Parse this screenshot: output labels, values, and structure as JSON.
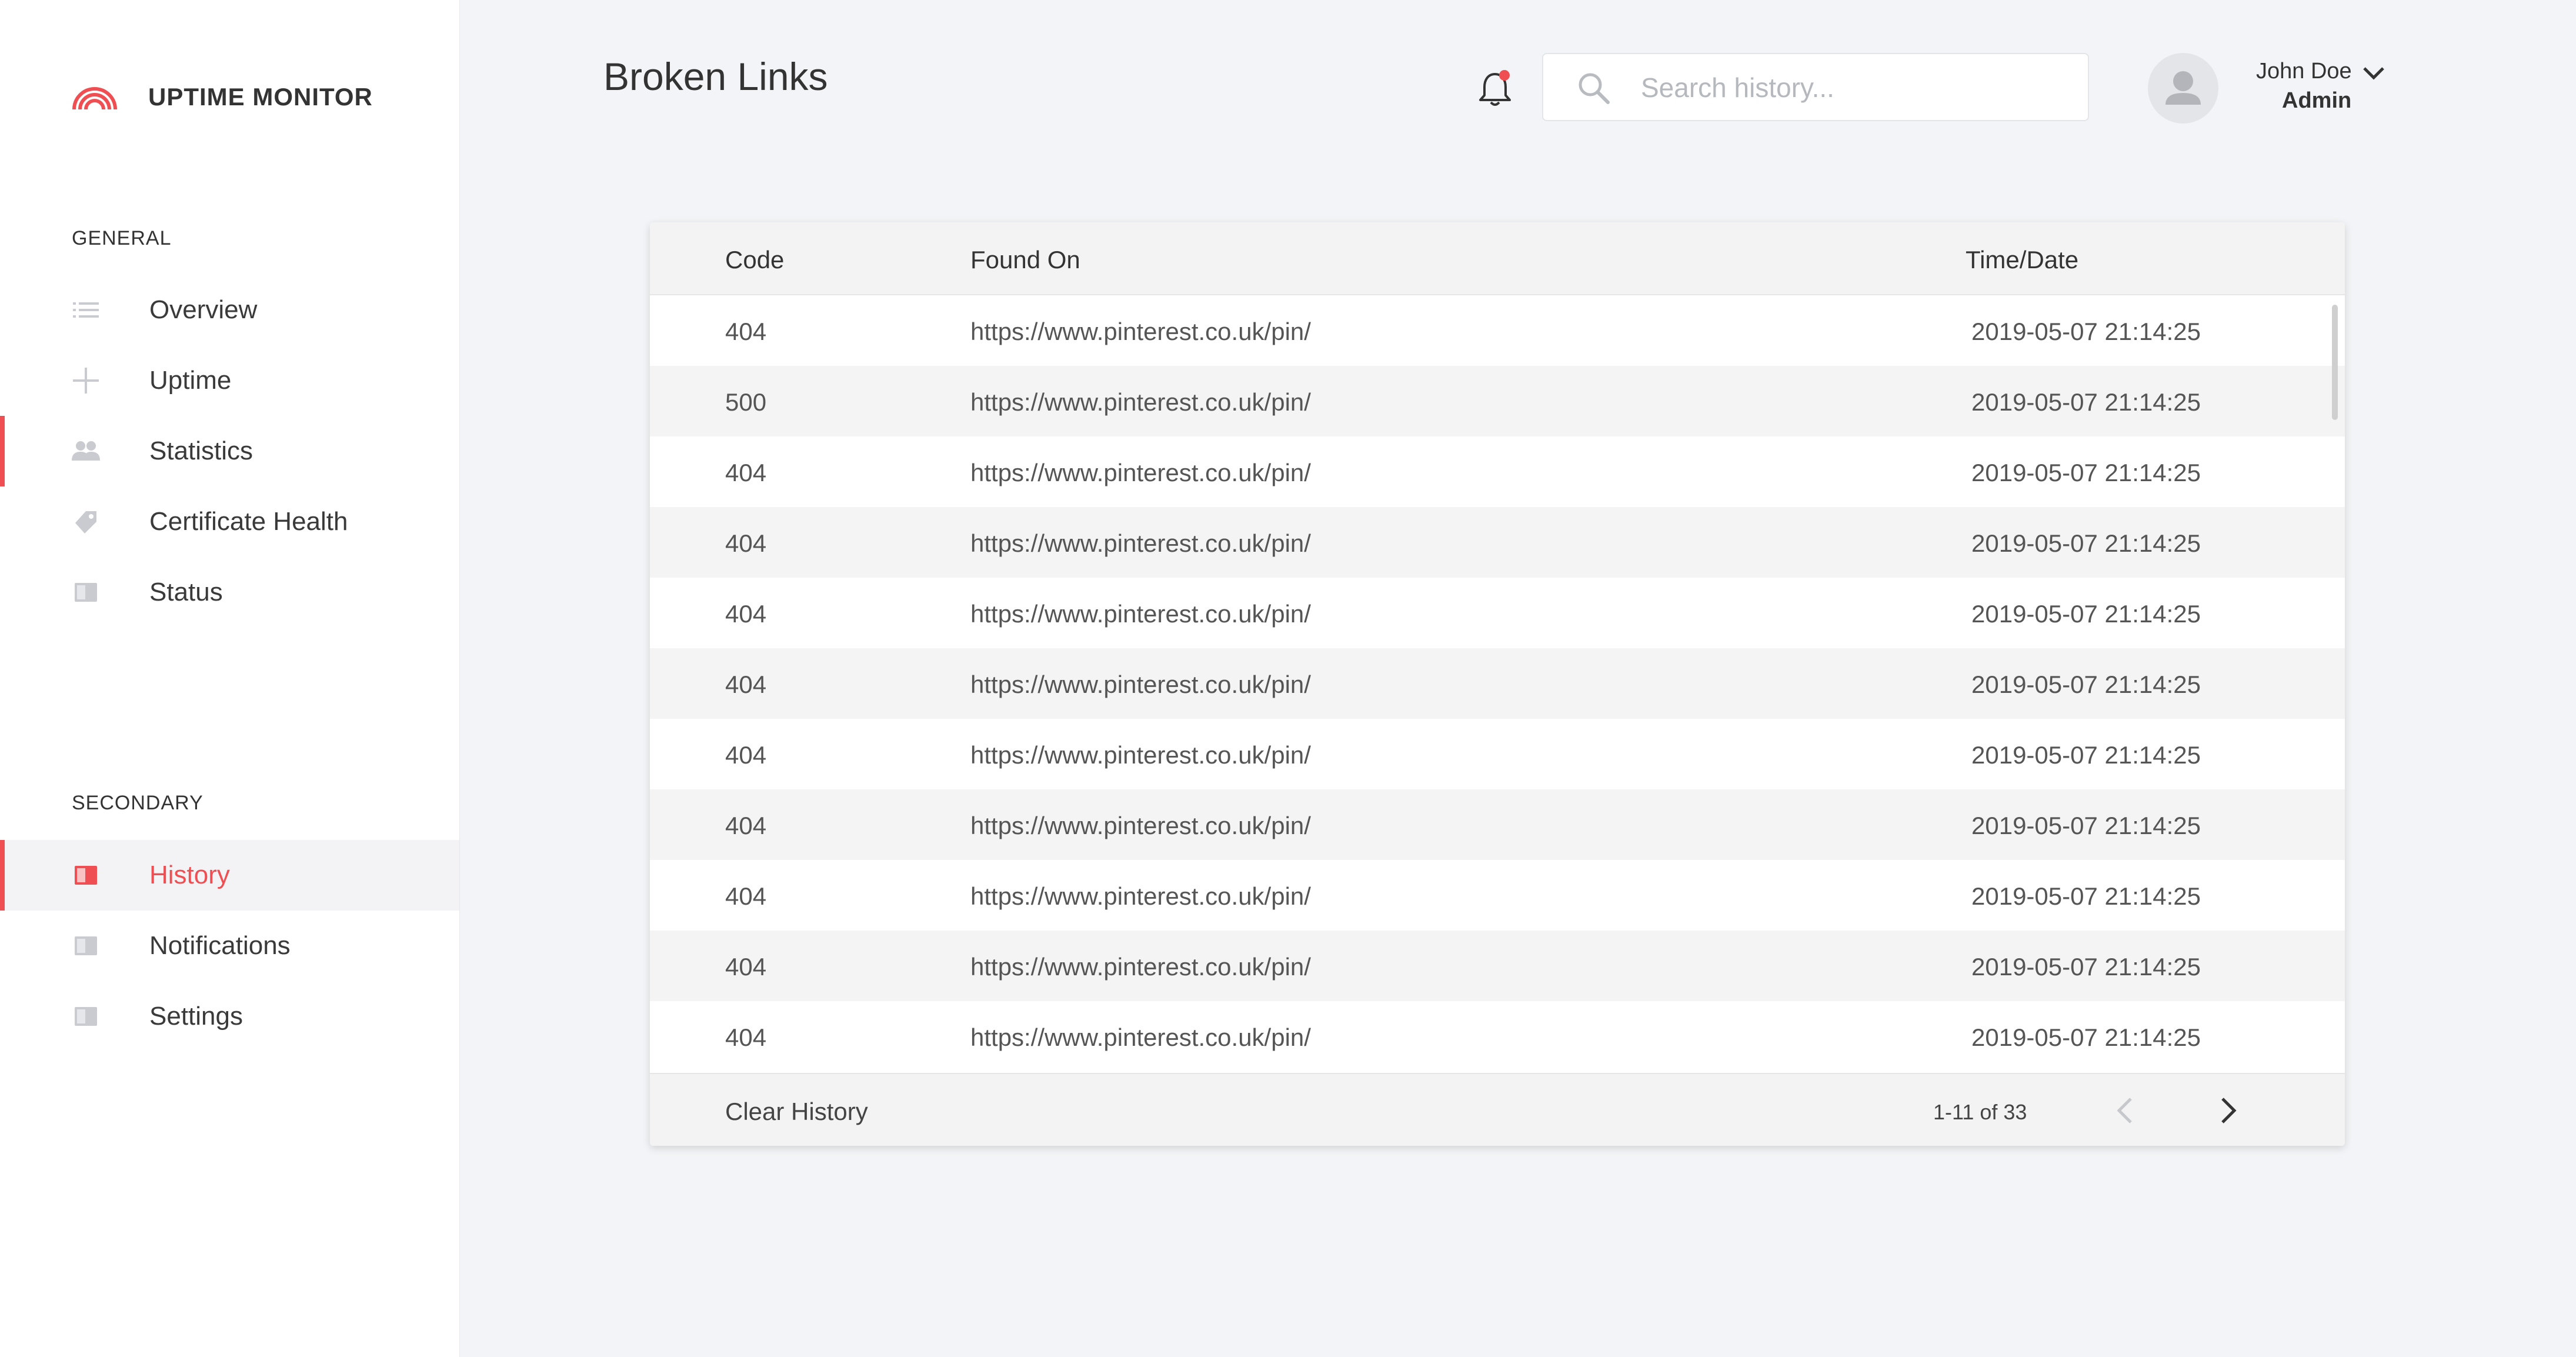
{
  "app": {
    "name": "UPTIME MONITOR"
  },
  "sidebar": {
    "general_title": "GENERAL",
    "general_items": [
      {
        "label": "Overview",
        "icon": "list-icon"
      },
      {
        "label": "Uptime",
        "icon": "plus-icon"
      },
      {
        "label": "Statistics",
        "icon": "users-icon"
      },
      {
        "label": "Certificate Health",
        "icon": "tag-icon"
      },
      {
        "label": "Status",
        "icon": "book-icon"
      }
    ],
    "secondary_title": "SECONDARY",
    "secondary_items": [
      {
        "label": "History",
        "icon": "book-icon",
        "active": true
      },
      {
        "label": "Notifications",
        "icon": "book-icon"
      },
      {
        "label": "Settings",
        "icon": "book-icon"
      }
    ]
  },
  "header": {
    "title": "Broken Links",
    "search_placeholder": "Search history...",
    "user_name": "John Doe",
    "user_role": "Admin"
  },
  "table": {
    "columns": [
      "Code",
      "Found On",
      "Time/Date"
    ],
    "rows": [
      [
        "404",
        "https://www.pinterest.co.uk/pin/",
        "2019-05-07 21:14:25"
      ],
      [
        "500",
        "https://www.pinterest.co.uk/pin/",
        "2019-05-07 21:14:25"
      ],
      [
        "404",
        "https://www.pinterest.co.uk/pin/",
        "2019-05-07 21:14:25"
      ],
      [
        "404",
        "https://www.pinterest.co.uk/pin/",
        "2019-05-07 21:14:25"
      ],
      [
        "404",
        "https://www.pinterest.co.uk/pin/",
        "2019-05-07 21:14:25"
      ],
      [
        "404",
        "https://www.pinterest.co.uk/pin/",
        "2019-05-07 21:14:25"
      ],
      [
        "404",
        "https://www.pinterest.co.uk/pin/",
        "2019-05-07 21:14:25"
      ],
      [
        "404",
        "https://www.pinterest.co.uk/pin/",
        "2019-05-07 21:14:25"
      ],
      [
        "404",
        "https://www.pinterest.co.uk/pin/",
        "2019-05-07 21:14:25"
      ],
      [
        "404",
        "https://www.pinterest.co.uk/pin/",
        "2019-05-07 21:14:25"
      ],
      [
        "404",
        "https://www.pinterest.co.uk/pin/",
        "2019-05-07 21:14:25"
      ]
    ],
    "clear_label": "Clear History",
    "pagination": "1-11 of 33"
  },
  "colors": {
    "accent": "#ef4f52",
    "background": "#f2f4f7",
    "sidebar": "#ffffff"
  }
}
